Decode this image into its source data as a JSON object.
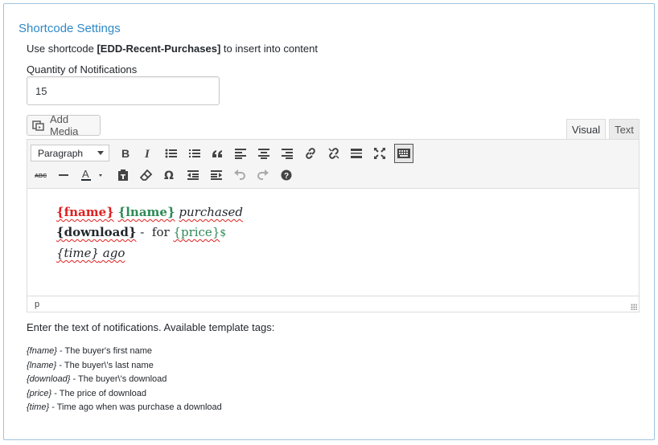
{
  "section": {
    "title": "Shortcode Settings",
    "shortcode_prefix": "Use shortcode ",
    "shortcode": "[EDD-Recent-Purchases]",
    "shortcode_suffix": " to insert into content"
  },
  "quantity": {
    "label": "Quantity of Notifications",
    "value": "15"
  },
  "editor": {
    "add_media_label": "Add Media",
    "tabs": {
      "visual": "Visual",
      "text": "Text"
    },
    "active_tab": "Visual",
    "format_select": "Paragraph",
    "toolbar_row1": [
      "bold-icon",
      "italic-icon",
      "bullet-list-icon",
      "numbered-list-icon",
      "blockquote-icon",
      "align-left-icon",
      "align-center-icon",
      "align-right-icon",
      "insert-link-icon",
      "remove-link-icon",
      "read-more-icon",
      "fullscreen-icon",
      "toolbar-toggle-icon"
    ],
    "toolbar_row2": [
      "strikethrough-icon",
      "horizontal-line-icon",
      "text-color-icon",
      "paste-as-text-icon",
      "clear-formatting-icon",
      "special-character-icon",
      "decrease-indent-icon",
      "increase-indent-icon",
      "undo-icon",
      "redo-icon",
      "help-icon"
    ],
    "strike_glyph": "ABC",
    "content": {
      "line1": {
        "fname": "{fname}",
        "lname": "{lname}",
        "purchased": "purchased"
      },
      "line2": {
        "download": "{download}",
        "sep": " -  for ",
        "price": "{price}",
        "currency": "$"
      },
      "line3": {
        "time": "{time}",
        "ago": " ago"
      }
    },
    "status_path": "p"
  },
  "help": {
    "title": "Enter the text of notifications. Available template tags:",
    "tags": [
      {
        "tag": "{fname}",
        "desc": " - The buyer's first name"
      },
      {
        "tag": "{lname}",
        "desc": " - The buyer\\'s last name"
      },
      {
        "tag": "{download}",
        "desc": " - The buyer\\'s download"
      },
      {
        "tag": "{price}",
        "desc": " - The price of download"
      },
      {
        "tag": "{time}",
        "desc": " - Time ago when was purchase a download"
      }
    ]
  },
  "colors": {
    "title_blue": "#2e89c8",
    "fname_red": "#e02020",
    "green": "#2e8b57",
    "border": "#9fc3dc"
  }
}
